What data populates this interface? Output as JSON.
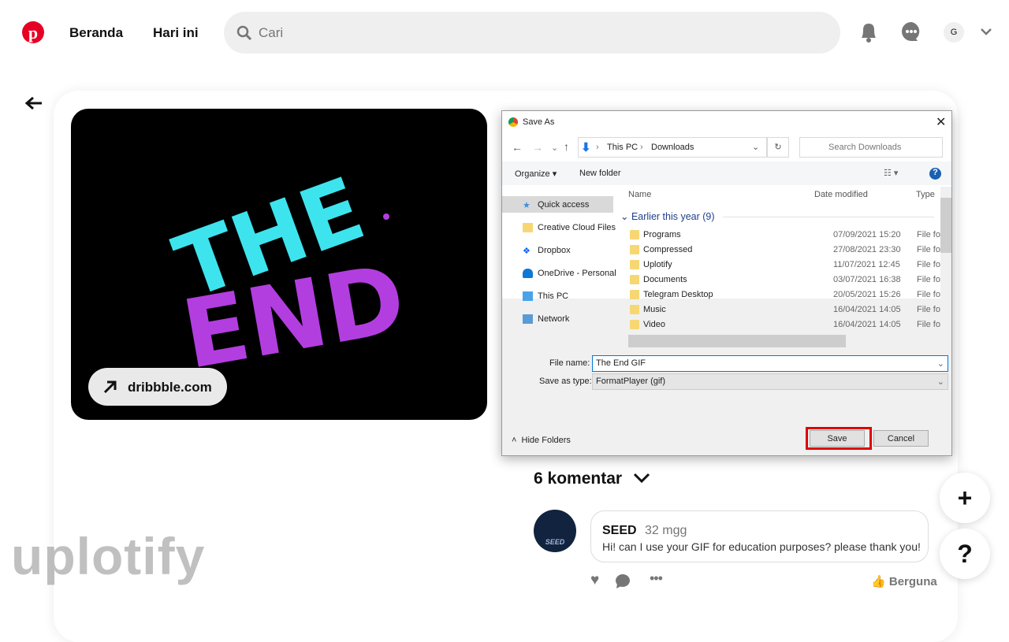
{
  "header": {
    "nav": [
      "Beranda",
      "Hari ini"
    ],
    "search_placeholder": "Cari",
    "avatar_initial": "G"
  },
  "pin": {
    "source_link": "dribbble.com",
    "artwork_text": [
      "THE",
      "END"
    ]
  },
  "dialog": {
    "title": "Save As",
    "breadcrumb": [
      "This PC",
      "Downloads"
    ],
    "search_placeholder": "Search Downloads",
    "organize": "Organize",
    "new_folder": "New folder",
    "sidebar": [
      "Quick access",
      "Creative Cloud Files",
      "Dropbox",
      "OneDrive - Personal",
      "This PC",
      "Network"
    ],
    "columns": [
      "Name",
      "Date modified",
      "Type"
    ],
    "group": "Earlier this year (9)",
    "files": [
      {
        "name": "Programs",
        "date": "07/09/2021 15:20",
        "type": "File fo"
      },
      {
        "name": "Compressed",
        "date": "27/08/2021 23:30",
        "type": "File fo"
      },
      {
        "name": "Uplotify",
        "date": "11/07/2021 12:45",
        "type": "File fo"
      },
      {
        "name": "Documents",
        "date": "03/07/2021 16:38",
        "type": "File fo"
      },
      {
        "name": "Telegram Desktop",
        "date": "20/05/2021 15:26",
        "type": "File fo"
      },
      {
        "name": "Music",
        "date": "16/04/2021 14:05",
        "type": "File fo"
      },
      {
        "name": "Video",
        "date": "16/04/2021 14:05",
        "type": "File fo"
      }
    ],
    "file_name_label": "File name:",
    "file_name": "The End GIF",
    "type_label": "Save as type:",
    "type_value": "FormatPlayer (gif)",
    "hide_folders": "Hide Folders",
    "save": "Save",
    "cancel": "Cancel",
    "highlight_color": "#e00000"
  },
  "comments": {
    "heading": "6 komentar",
    "items": [
      {
        "author": "SEED",
        "time": "32 mgg",
        "text": "Hi! can I use your GIF for education purposes? please thank you!",
        "avatar_text": "SEED"
      }
    ],
    "helpful": "Berguna"
  },
  "fab": {
    "plus": "+",
    "help": "?"
  },
  "watermark": "uplotify"
}
